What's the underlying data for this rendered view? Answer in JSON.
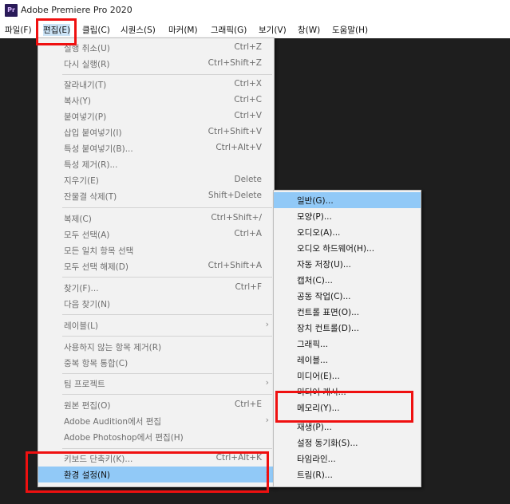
{
  "window": {
    "icon_text": "Pr",
    "title": "Adobe Premiere Pro 2020"
  },
  "menubar": [
    "파일(F)",
    "편집(E)",
    "클립(C)",
    "시퀀스(S)",
    "마커(M)",
    "그래픽(G)",
    "보기(V)",
    "창(W)",
    "도움말(H)"
  ],
  "edit_menu": {
    "items": [
      {
        "label": "실행 취소(U)",
        "shortcut": "Ctrl+Z"
      },
      {
        "label": "다시 실행(R)",
        "shortcut": "Ctrl+Shift+Z"
      },
      {
        "label": "잘라내기(T)",
        "shortcut": "Ctrl+X"
      },
      {
        "label": "복사(Y)",
        "shortcut": "Ctrl+C"
      },
      {
        "label": "붙여넣기(P)",
        "shortcut": "Ctrl+V"
      },
      {
        "label": "삽입 붙여넣기(I)",
        "shortcut": "Ctrl+Shift+V"
      },
      {
        "label": "특성 붙여넣기(B)...",
        "shortcut": "Ctrl+Alt+V"
      },
      {
        "label": "특성 제거(R)...",
        "shortcut": ""
      },
      {
        "label": "지우기(E)",
        "shortcut": "Delete"
      },
      {
        "label": "잔물결 삭제(T)",
        "shortcut": "Shift+Delete"
      },
      {
        "label": "복제(C)",
        "shortcut": "Ctrl+Shift+/"
      },
      {
        "label": "모두 선택(A)",
        "shortcut": "Ctrl+A"
      },
      {
        "label": "모든 일치 항목 선택",
        "shortcut": ""
      },
      {
        "label": "모두 선택 해제(D)",
        "shortcut": "Ctrl+Shift+A"
      },
      {
        "label": "찾기(F)...",
        "shortcut": "Ctrl+F"
      },
      {
        "label": "다음 찾기(N)",
        "shortcut": ""
      },
      {
        "label": "레이블(L)",
        "shortcut": ""
      },
      {
        "label": "사용하지 않는 항목 제거(R)",
        "shortcut": ""
      },
      {
        "label": "중복 항목 통합(C)",
        "shortcut": ""
      },
      {
        "label": "팀 프로젝트",
        "shortcut": ""
      },
      {
        "label": "원본 편집(O)",
        "shortcut": "Ctrl+E"
      },
      {
        "label": "Adobe Audition에서 편집",
        "shortcut": ""
      },
      {
        "label": "Adobe Photoshop에서 편집(H)",
        "shortcut": ""
      },
      {
        "label": "키보드 단축키(K)...",
        "shortcut": "Ctrl+Alt+K"
      },
      {
        "label": "환경 설정(N)",
        "shortcut": ""
      }
    ],
    "submenu_arrow": "›"
  },
  "preferences_submenu": [
    "일반(G)...",
    "모양(P)...",
    "오디오(A)...",
    "오디오 하드웨어(H)...",
    "자동 저장(U)...",
    "캡처(C)...",
    "공동 작업(C)...",
    "컨트롤 표면(O)...",
    "장치 컨트롤(D)...",
    "그래픽...",
    "레이블...",
    "미디어(E)...",
    "미디어 캐시...",
    "메모리(Y)...",
    "재생(P)...",
    "설정 동기화(S)...",
    "타임라인...",
    "트림(R)..."
  ],
  "colors": {
    "highlight": "#91c9f7",
    "annotation_red": "#ef1010"
  }
}
